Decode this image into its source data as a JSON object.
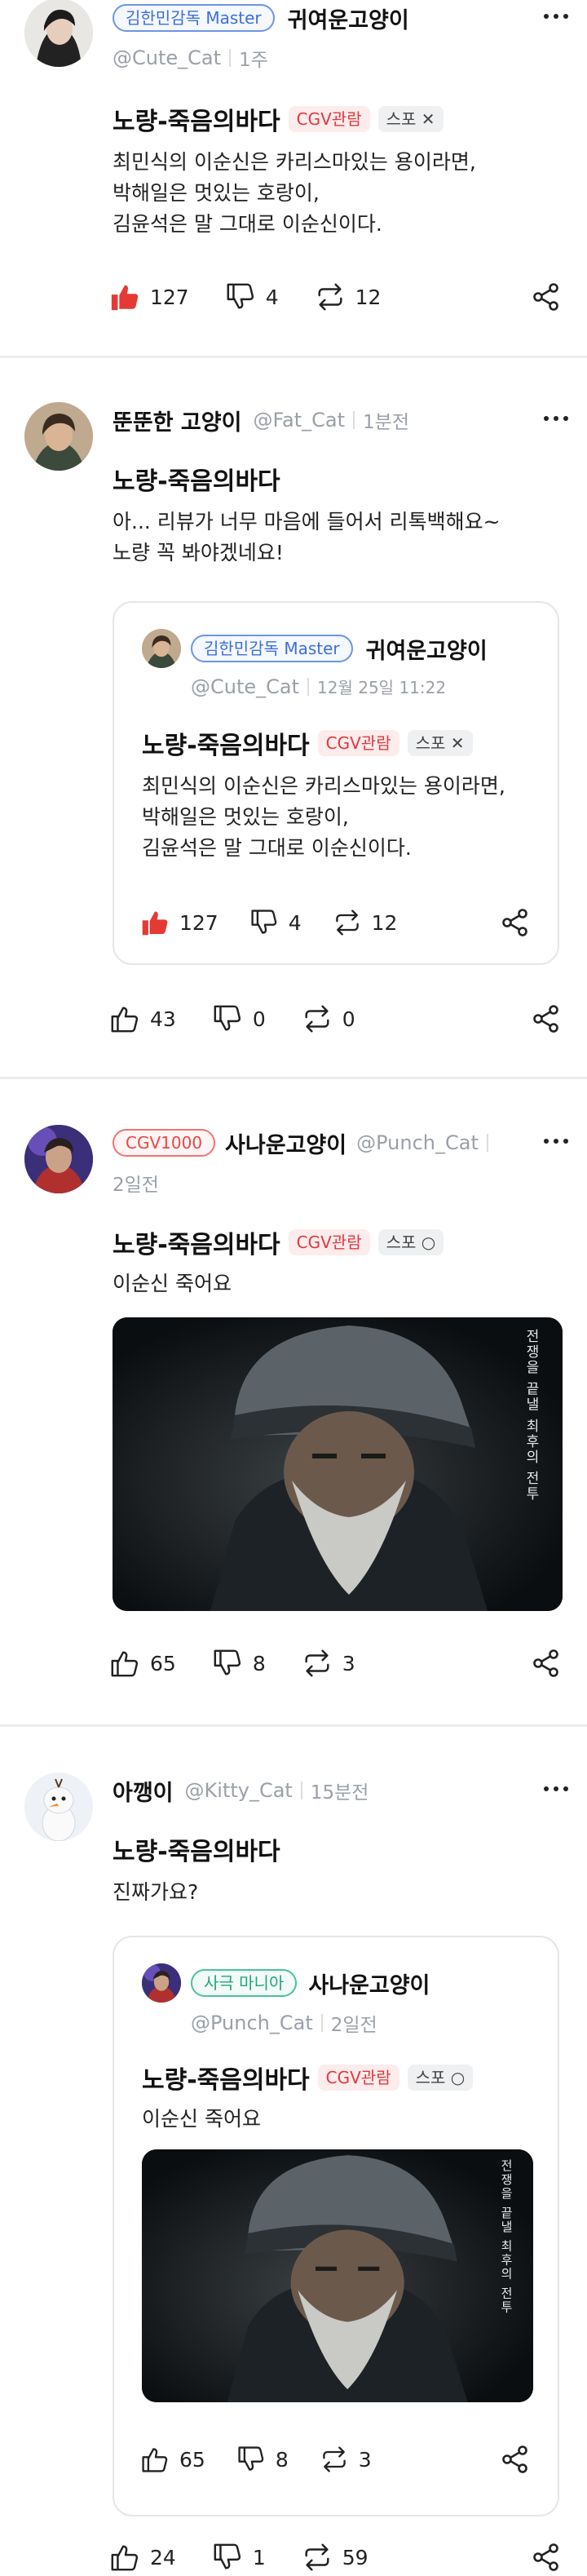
{
  "posts": [
    {
      "user": {
        "badge": "김한민감독 Master",
        "name": "귀여운고양이",
        "handle": "@Cute_Cat",
        "time": "1주"
      },
      "title": "노량-죽음의바다",
      "tags": {
        "cgv": "CGV관람",
        "spoiler": "스포 ✕"
      },
      "text": "최민식의 이순신은 카리스마있는 용이라면,\n박해일은 멋있는 호랑이,\n김윤석은 말 그대로 이순신이다.",
      "likes": "127",
      "dislikes": "4",
      "reposts": "12"
    },
    {
      "user": {
        "name": "뚠뚠한 고양이",
        "handle": "@Fat_Cat",
        "time": "1분전"
      },
      "title": "노량-죽음의바다",
      "text": "아... 리뷰가 너무 마음에 들어서 리톡백해요~\n노량 꼭 봐야겠네요!",
      "quote": {
        "badge": "김한민감독 Master",
        "name": "귀여운고양이",
        "handle": "@Cute_Cat",
        "time": "12월 25일 11:22",
        "title": "노량-죽음의바다",
        "tags": {
          "cgv": "CGV관람",
          "spoiler": "스포 ✕"
        },
        "text": "최민식의 이순신은 카리스마있는 용이라면,\n박해일은 멋있는 호랑이,\n김윤석은 말 그대로 이순신이다.",
        "likes": "127",
        "dislikes": "4",
        "reposts": "12"
      },
      "likes": "43",
      "dislikes": "0",
      "reposts": "0"
    },
    {
      "user": {
        "badge": "CGV1000",
        "name": "사나운고양이",
        "handle": "@Punch_Cat",
        "time": "2일전"
      },
      "title": "노량-죽음의바다",
      "tags": {
        "cgv": "CGV관람",
        "spoiler": "스포 ○"
      },
      "text": "이순신 죽어요",
      "poster_caption": "전쟁을 끝낼 최후의 전투",
      "likes": "65",
      "dislikes": "8",
      "reposts": "3"
    },
    {
      "user": {
        "name": "아깽이",
        "handle": "@Kitty_Cat",
        "time": "15분전"
      },
      "title": "노량-죽음의바다",
      "text": "진짜가요?",
      "quote": {
        "badge": "사극 마니아",
        "name": "사나운고양이",
        "handle": "@Punch_Cat",
        "time": "2일전",
        "title": "노량-죽음의바다",
        "tags": {
          "cgv": "CGV관람",
          "spoiler": "스포 ○"
        },
        "text": "이순신 죽어요",
        "poster_caption": "전쟁을 끝낼 최후의 전투",
        "likes": "65",
        "dislikes": "8",
        "reposts": "3"
      },
      "likes": "24",
      "dislikes": "1",
      "reposts": "59"
    }
  ],
  "icons": {
    "like": "thumbs-up-icon",
    "dislike": "thumbs-down-icon",
    "repost": "repost-icon",
    "share": "share-icon",
    "more": "more-icon"
  },
  "colors": {
    "accent_red": "#ef4444",
    "badge_blue": "#3b6fd8",
    "badge_green": "#20a47c",
    "muted": "#9aa0a8"
  }
}
